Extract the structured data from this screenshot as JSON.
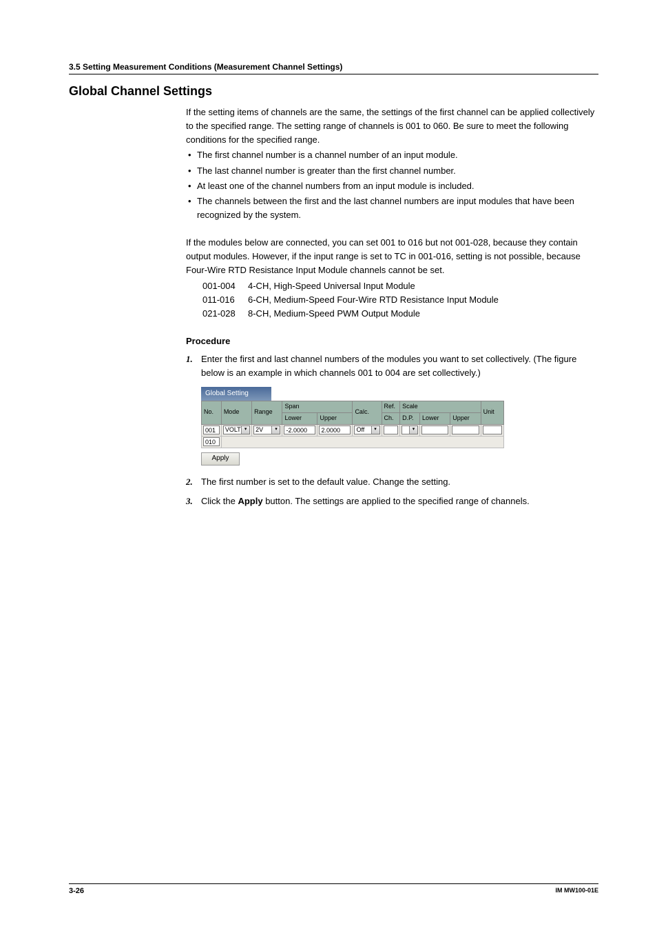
{
  "breadcrumb": "3.5  Setting Measurement Conditions (Measurement Channel Settings)",
  "heading": "Global Channel Settings",
  "intro": [
    "If the setting items of channels are the same, the settings of the first channel can be applied collectively to the specified range. The setting range of channels is 001 to 060. Be sure to meet the following conditions for the specified range."
  ],
  "conditions": [
    "The first channel number is a channel number of an input module.",
    "The last channel number is greater than the first channel number.",
    "At least one of the channel numbers from an input module is included.",
    "The channels between the first and the last channel numbers are input modules that have been recognized by the system."
  ],
  "note": "If the modules below are connected, you can set 001 to 016 but not 001-028, because they contain output modules. However, if the input range is set to TC in 001-016, setting is not possible, because Four-Wire RTD Resistance Input Module channels cannot be set.",
  "modules": [
    {
      "range": "001-004",
      "desc": "4-CH, High-Speed Universal Input Module"
    },
    {
      "range": "011-016",
      "desc": "6-CH, Medium-Speed Four-Wire RTD Resistance Input Module"
    },
    {
      "range": "021-028",
      "desc": "8-CH, Medium-Speed PWM Output Module"
    }
  ],
  "procedure_label": "Procedure",
  "steps": {
    "s1": "Enter the first and last channel numbers of the modules you want to set collectively. (The figure below is an example in which channels 001 to 004 are set collectively.)",
    "s2": "The first number is set to the default value. Change the setting.",
    "s3_prefix": "Click the ",
    "s3_bold": "Apply",
    "s3_suffix": " button. The settings are applied to the specified range of channels."
  },
  "ui": {
    "title": "Global Setting",
    "headers": {
      "no": "No.",
      "mode": "Mode",
      "range": "Range",
      "span": "Span",
      "span_lower": "Lower",
      "span_upper": "Upper",
      "calc": "Calc.",
      "ref": "Ref.",
      "ref2": "Ch.",
      "scale": "Scale",
      "scale_dp": "D.P.",
      "scale_lower": "Lower",
      "scale_upper": "Upper",
      "unit": "Unit"
    },
    "row1": {
      "no": "001",
      "mode": "VOLT",
      "range": "2V",
      "lower": "-2.0000",
      "upper": "2.0000",
      "calc": "Off",
      "ref": "",
      "dp": "",
      "s_lower": "",
      "s_upper": "",
      "unit": ""
    },
    "row2": {
      "no": "010"
    },
    "apply": "Apply"
  },
  "footer": {
    "left": "3-26",
    "right": "IM MW100-01E"
  }
}
